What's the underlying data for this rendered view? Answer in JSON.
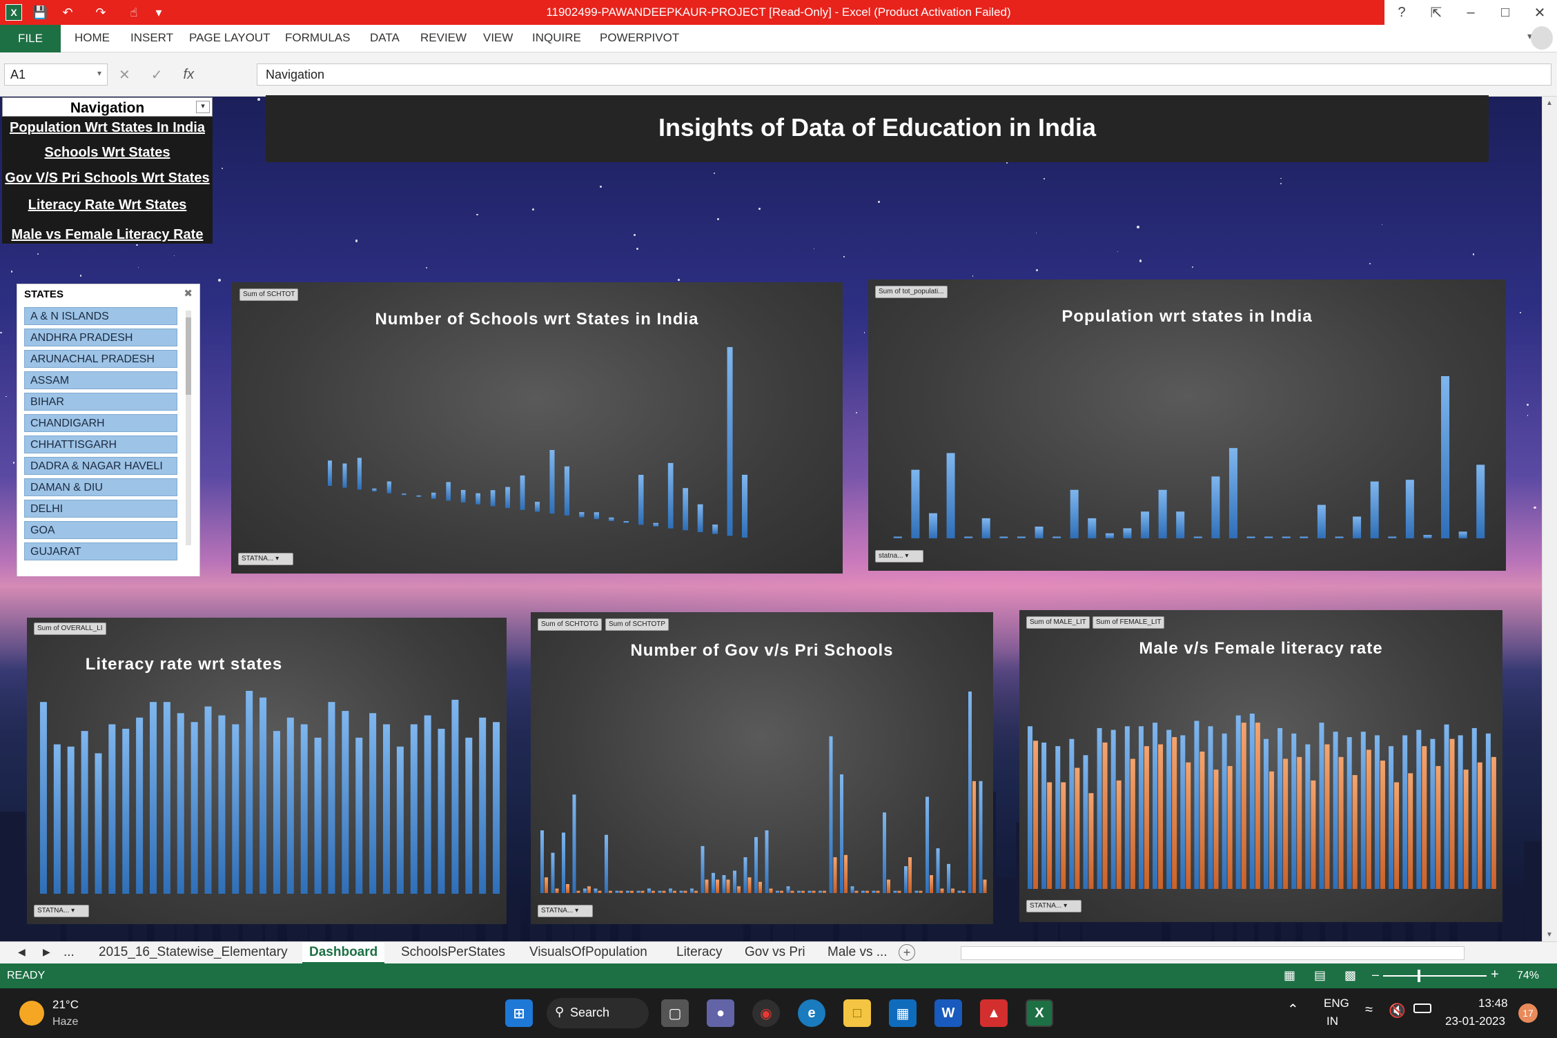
{
  "window": {
    "title": "11902499-PAWANDEEPKAUR-PROJECT  [Read-Only]  -  Excel (Product Activation Failed)"
  },
  "ribbon": {
    "file": "FILE",
    "tabs": [
      "HOME",
      "INSERT",
      "PAGE LAYOUT",
      "FORMULAS",
      "DATA",
      "REVIEW",
      "VIEW",
      "INQUIRE",
      "POWERPIVOT"
    ]
  },
  "formula_bar": {
    "name_box": "A1",
    "fx": "fx",
    "content": "Navigation"
  },
  "navigation": {
    "header": "Navigation",
    "links": [
      "Population Wrt States In India",
      "Schools Wrt States",
      "Gov V/S Pri Schools Wrt States",
      "Literacy Rate Wrt States",
      "Male vs Female Literacy Rate"
    ]
  },
  "slicer": {
    "title": "STATES",
    "items": [
      "A & N ISLANDS",
      "ANDHRA PRADESH",
      "ARUNACHAL PRADESH",
      "ASSAM",
      "BIHAR",
      "CHANDIGARH",
      "CHHATTISGARH",
      "DADRA & NAGAR HAVELI",
      "DAMAN & DIU",
      "DELHI",
      "GOA",
      "GUJARAT"
    ]
  },
  "banner": {
    "title": "Insights of Data of Education in India"
  },
  "charts": {
    "schools": {
      "field_button": "Sum of SCHTOT",
      "axis_button": "STATNA..."
    },
    "population": {
      "field_button": "Sum of tot_populati...",
      "axis_button": "statna..."
    },
    "literacy": {
      "field_button": "Sum of OVERALL_LI",
      "axis_button": "STATNA..."
    },
    "govpri": {
      "field_buttons": [
        "Sum of SCHTOTG",
        "Sum of SCHTOTP"
      ],
      "axis_button": "STATNA..."
    },
    "malefemale": {
      "field_buttons": [
        "Sum of MALE_LIT",
        "Sum of FEMALE_LIT"
      ],
      "axis_button": "STATNA..."
    }
  },
  "chart_data": [
    {
      "type": "bar",
      "title": "Number of Schools wrt States in India",
      "series": [
        {
          "values": [
            18,
            17,
            22,
            2,
            8,
            1,
            1,
            4,
            12,
            8,
            7,
            10,
            13,
            21,
            6,
            38,
            29,
            3,
            4,
            2,
            1,
            28,
            2,
            36,
            23,
            15,
            5,
            100,
            33
          ]
        }
      ]
    },
    {
      "type": "bar",
      "title": "Population wrt states in India",
      "series": [
        {
          "values": [
            1,
            41,
            15,
            51,
            1,
            12,
            1,
            1,
            7,
            1,
            29,
            12,
            3,
            6,
            16,
            29,
            16,
            1,
            37,
            54,
            1,
            1,
            1,
            1,
            20,
            1,
            13,
            34,
            1,
            35,
            2,
            97,
            4,
            44
          ]
        }
      ]
    },
    {
      "type": "bar",
      "title": "Literacy rate wrt states",
      "series": [
        {
          "values": [
            86,
            67,
            66,
            73,
            63,
            76,
            74,
            79,
            86,
            86,
            81,
            77,
            84,
            80,
            76,
            91,
            88,
            73,
            79,
            76,
            70,
            86,
            82,
            70,
            81,
            76,
            66,
            76,
            80,
            74,
            87,
            70,
            79,
            77
          ]
        }
      ]
    },
    {
      "type": "bar",
      "title": "Number of Gov v/s Pri Schools",
      "series": [
        {
          "values": [
            28,
            18,
            27,
            44,
            2,
            2,
            26,
            1,
            1,
            1,
            2,
            1,
            2,
            1,
            2,
            21,
            9,
            8,
            10,
            16,
            25,
            28,
            1,
            3,
            1,
            1,
            1,
            70,
            53,
            3,
            1,
            1,
            36,
            1,
            12,
            1,
            43,
            20,
            13,
            1,
            90,
            50
          ]
        },
        {
          "values": [
            7,
            2,
            4,
            1,
            3,
            1,
            1,
            1,
            1,
            1,
            1,
            1,
            1,
            1,
            1,
            6,
            6,
            6,
            3,
            7,
            5,
            2,
            1,
            1,
            1,
            1,
            1,
            16,
            17,
            1,
            1,
            1,
            6,
            1,
            16,
            1,
            8,
            2,
            2,
            1,
            50,
            6
          ]
        }
      ]
    },
    {
      "type": "bar",
      "title": "Male v/s Female literacy rate",
      "series": [
        {
          "values": [
            90,
            81,
            79,
            83,
            74,
            89,
            88,
            90,
            90,
            92,
            88,
            85,
            93,
            90,
            86,
            96,
            97,
            83,
            89,
            86,
            80,
            92,
            87,
            84,
            87,
            85,
            79,
            85,
            88,
            83,
            91,
            85,
            89,
            86
          ]
        },
        {
          "values": [
            82,
            59,
            59,
            67,
            53,
            81,
            60,
            72,
            79,
            80,
            84,
            70,
            76,
            66,
            68,
            92,
            92,
            65,
            72,
            73,
            60,
            80,
            73,
            63,
            77,
            71,
            59,
            64,
            79,
            68,
            83,
            66,
            70,
            73
          ]
        }
      ]
    }
  ],
  "sheet_tabs": {
    "ellipsis": "...",
    "tabs": [
      "2015_16_Statewise_Elementary",
      "Dashboard",
      "SchoolsPerStates",
      "VisualsOfPopulation",
      "Literacy",
      "Gov vs Pri",
      "Male vs ..."
    ],
    "active": "Dashboard"
  },
  "status": {
    "ready": "READY",
    "zoom": "74%"
  },
  "taskbar": {
    "weather_temp": "21°C",
    "weather_desc": "Haze",
    "search": "Search",
    "lang1": "ENG",
    "lang2": "IN",
    "time": "13:48",
    "date": "23-01-2023",
    "badge": "17"
  }
}
